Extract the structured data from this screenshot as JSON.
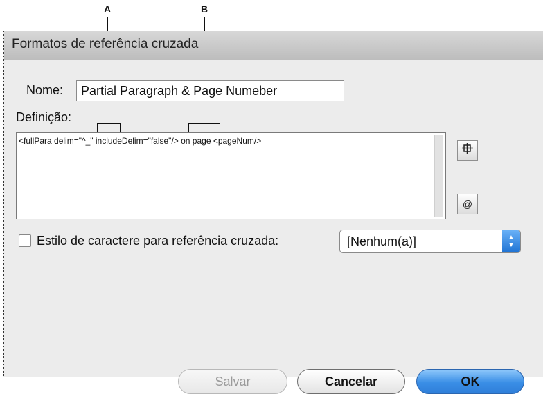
{
  "callouts": {
    "a": "A",
    "b": "B"
  },
  "dialog": {
    "title": "Formatos de referência cruzada"
  },
  "form": {
    "name_label": "Nome:",
    "name_value": "Partial Paragraph & Page Numeber",
    "definition_label": "Definição:",
    "definition_value": "<fullPara delim=\"^_\" includeDelim=\"false\"/> on page <pageNum/>"
  },
  "side_buttons": {
    "insert_building_block_icon": "building-block-icon",
    "insert_special_char_icon": "at-sign-icon",
    "insert_special_char_glyph": "@"
  },
  "char_style": {
    "checkbox_label": "Estilo de caractere para referência cruzada:",
    "checked": false,
    "selected": "[Nenhum(a)]"
  },
  "buttons": {
    "save": "Salvar",
    "cancel": "Cancelar",
    "ok": "OK"
  },
  "colors": {
    "ok_accent": "#3a8ee6",
    "popup_accent": "#1f73d4"
  }
}
